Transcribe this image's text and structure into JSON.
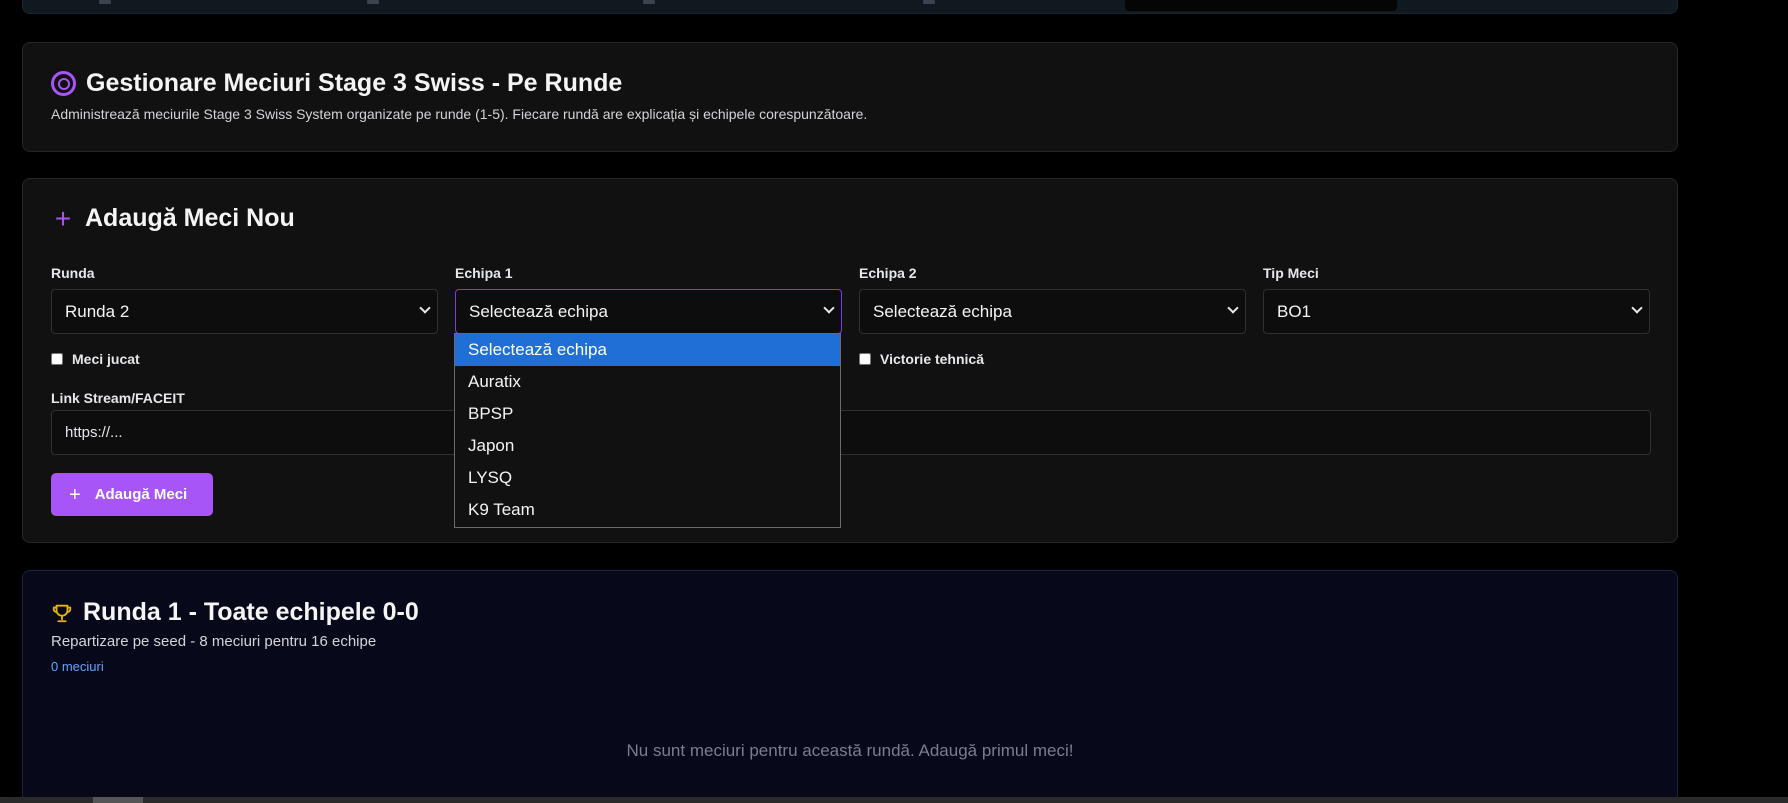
{
  "header": {
    "title": "Gestionare Meciuri Stage 3 Swiss - Pe Runde",
    "subtitle": "Administrează meciurile Stage 3 Swiss System organizate pe runde (1-5). Fiecare rundă are explicația și echipele corespunzătoare.",
    "icon": "target-icon"
  },
  "add_match": {
    "title": "Adaugă Meci Nou",
    "icon": "plus-icon",
    "round_label": "Runda",
    "round_value": "Runda 2",
    "team1_label": "Echipa 1",
    "team1_value": "Selectează echipa",
    "team2_label": "Echipa 2",
    "team2_value": "Selectează echipa",
    "type_label": "Tip Meci",
    "type_value": "BO1",
    "played_label": "Meci jucat",
    "tech_win_label": "Victorie tehnică",
    "stream_label": "Link Stream/FACEIT",
    "stream_placeholder": "https://...",
    "submit_label": "Adaugă Meci",
    "accent_color": "#a855f7"
  },
  "team1_dropdown": {
    "options": [
      "Selectează echipa",
      "Auratix",
      "BPSP",
      "Japon",
      "LYSQ",
      "K9 Team"
    ],
    "selected_index": 0
  },
  "round1": {
    "title": "Runda 1 - Toate echipele 0-0",
    "subtitle": "Repartizare pe seed - 8 meciuri pentru 16 echipe",
    "count": "0 meciuri",
    "empty_message": "Nu sunt meciuri pentru această rundă. Adaugă primul meci!",
    "icon": "trophy-icon"
  }
}
